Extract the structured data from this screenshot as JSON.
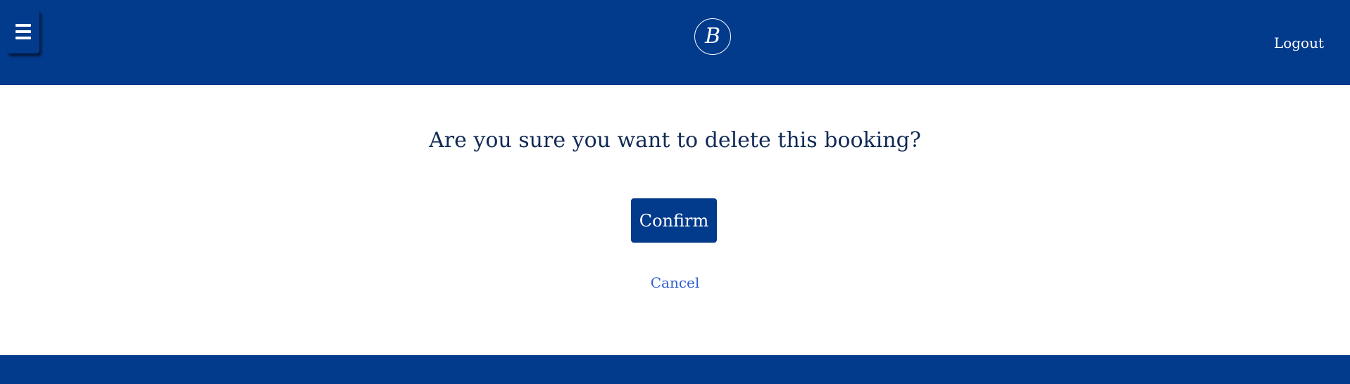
{
  "header": {
    "menu_icon": "hamburger-menu-icon",
    "logo_letter": "B",
    "logout_label": "Logout"
  },
  "dialog": {
    "question": "Are you sure you want to delete this booking?",
    "confirm_label": "Confirm",
    "cancel_label": "Cancel"
  },
  "colors": {
    "brand": "#023a8c",
    "question_text": "#112a55",
    "link": "#2f5fd2",
    "background": "#ffffff"
  }
}
